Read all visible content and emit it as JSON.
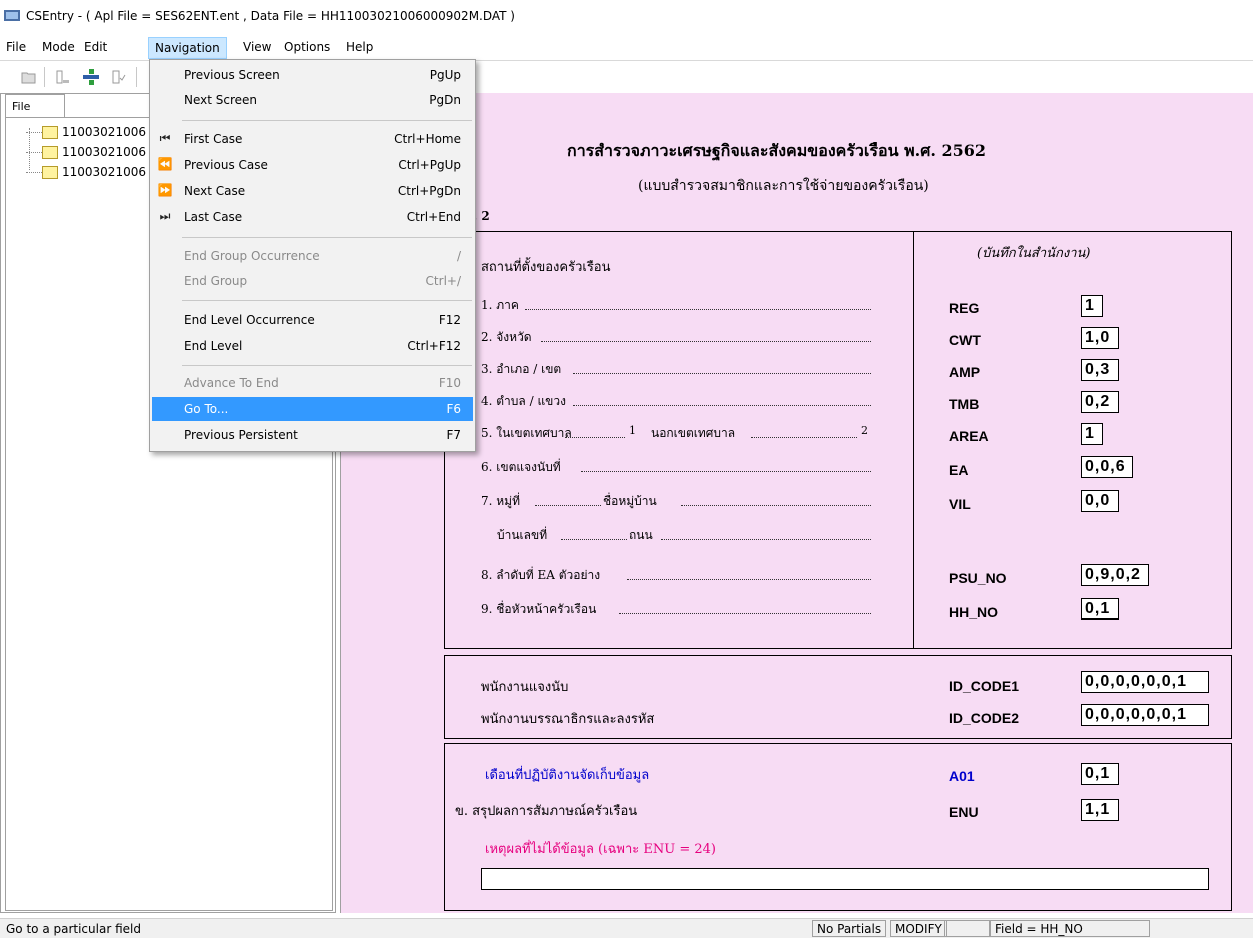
{
  "window": {
    "title": "CSEntry - ( Apl File = SES62ENT.ent , Data File = HH11003021006000902M.DAT )"
  },
  "menubar": {
    "items": [
      "File",
      "Mode",
      "Edit",
      "Navigation",
      "View",
      "Options",
      "Help"
    ],
    "active": "Navigation"
  },
  "sidebar": {
    "tab_label": "File",
    "cases": [
      "11003021006",
      "11003021006",
      "11003021006"
    ]
  },
  "navigation_menu": {
    "previous_screen": {
      "label": "Previous Screen",
      "shortcut": "PgUp"
    },
    "next_screen": {
      "label": "Next Screen",
      "shortcut": "PgDn"
    },
    "first_case": {
      "label": "First Case",
      "shortcut": "Ctrl+Home"
    },
    "previous_case": {
      "label": "Previous Case",
      "shortcut": "Ctrl+PgUp"
    },
    "next_case": {
      "label": "Next Case",
      "shortcut": "Ctrl+PgDn"
    },
    "last_case": {
      "label": "Last Case",
      "shortcut": "Ctrl+End"
    },
    "end_group_occurrence": {
      "label": "End Group Occurrence",
      "shortcut": "/"
    },
    "end_group": {
      "label": "End Group",
      "shortcut": "Ctrl+/"
    },
    "end_level_occurrence": {
      "label": "End Level Occurrence",
      "shortcut": "F12"
    },
    "end_level": {
      "label": "End Level",
      "shortcut": "Ctrl+F12"
    },
    "advance_to_end": {
      "label": "Advance To End",
      "shortcut": "F10"
    },
    "go_to": {
      "label": "Go To...",
      "shortcut": "F6"
    },
    "previous_persistent": {
      "label": "Previous Persistent",
      "shortcut": "F7"
    }
  },
  "form": {
    "title": "การสำรวจภาวะเศรษฐกิจและสังคมของครัวเรือน พ.ศ. 2562",
    "subtitle": "(แบบสำรวจสมาชิกและการใช้จ่ายของครัวเรือน)",
    "form_code_fragment": ". 2",
    "office_note": "(บันทึกในสำนักงาน)",
    "location_heading": "สถานที่ตั้งของครัวเรือน",
    "rows": {
      "region": {
        "label": "1. ภาค",
        "code": "REG",
        "value": "1"
      },
      "province": {
        "label": "2. จังหวัด",
        "code": "CWT",
        "value": "1,0"
      },
      "district": {
        "label": "3. อำเภอ / เขต",
        "code": "AMP",
        "value": "0,3"
      },
      "subdistrict": {
        "label": "4. ตำบล / แขวง",
        "code": "TMB",
        "value": "0,2"
      },
      "area": {
        "label": "5. ในเขตเทศบาล",
        "code_in": "1",
        "label_out": "นอกเขตเทศบาล",
        "code_out": "2",
        "code": "AREA",
        "value": "1"
      },
      "ea": {
        "label": "6. เขตแจงนับที่",
        "code": "EA",
        "value": "0,0,6"
      },
      "village": {
        "label": "7. หมู่ที่",
        "label2": "ชื่อหมู่บ้าน",
        "code": "VIL",
        "value": "0,0"
      },
      "house": {
        "label": "บ้านเลขที่",
        "label2": "ถนน"
      },
      "psu": {
        "label": "8. ลำดับที่ EA ตัวอย่าง",
        "code": "PSU_NO",
        "value": "0,9,0,2"
      },
      "head": {
        "label": "9. ชื่อหัวหน้าครัวเรือน",
        "code": "HH_NO",
        "value": "0,1"
      }
    },
    "staff": {
      "enumerator": {
        "label": "พนักงานแจงนับ",
        "code": "ID_CODE1",
        "value": "0,0,0,0,0,0,1"
      },
      "editor": {
        "label": "พนักงานบรรณาธิกรและลงรหัส",
        "code": "ID_CODE2",
        "value": "0,0,0,0,0,0,1"
      }
    },
    "collection": {
      "month": {
        "label": "เดือนที่ปฏิบัติงานจัดเก็บข้อมูล",
        "code": "A01",
        "value": "0,1"
      },
      "result": {
        "label": "ข.  สรุปผลการสัมภาษณ์ครัวเรือน",
        "code": "ENU",
        "value": "1,1"
      },
      "reason": {
        "label": "เหตุผลที่ไม่ได้ข้อมูล (เฉพาะ ENU = 24)",
        "value": ""
      }
    }
  },
  "statusbar": {
    "message": "Go to a particular field",
    "partials": "No Partials",
    "mode": "MODIFY",
    "blank": "",
    "field": "Field = HH_NO"
  },
  "colors": {
    "form_background": "#f7dcf4",
    "menu_highlight": "#3399ff",
    "blue_label": "#0000cc",
    "pink_label": "#e6007e"
  }
}
